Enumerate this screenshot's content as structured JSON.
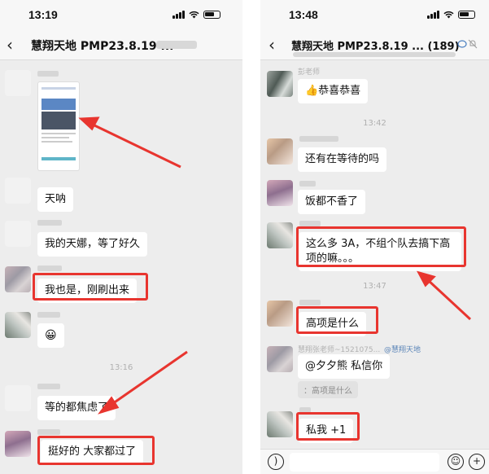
{
  "left": {
    "status_time": "13:19",
    "nav_title": "慧翔天地 PMP23.8.19 ...",
    "timestamps": [
      "13:16"
    ],
    "messages": [
      {
        "text": "天呐"
      },
      {
        "text": "我的天娜，等了好久"
      },
      {
        "text": "我也是，刚刷出来"
      },
      {
        "text": "😀"
      },
      {
        "text": "等的都焦虑了"
      },
      {
        "text": "挺好的 大家都过了"
      }
    ],
    "icons": {
      "back": "back-chevron-icon",
      "signal": "signal-icon",
      "wifi": "wifi-icon",
      "battery": "battery-icon"
    }
  },
  "right": {
    "status_time": "13:48",
    "nav_title": "慧翔天地 PMP23.8.19 ... (189)",
    "timestamps": [
      "13:42",
      "13:47"
    ],
    "sender_names": [
      "彭老师",
      "慧翔张老师~1521075..."
    ],
    "group_tag": "@慧翔天地",
    "messages": [
      {
        "text": "👍恭喜恭喜"
      },
      {
        "text": "还有在等待的吗"
      },
      {
        "text": "饭都不香了"
      },
      {
        "text": "这么多 3A，不组个队去搞下高项的嘛。。。"
      },
      {
        "text": "高项是什么"
      },
      {
        "text": "@夕夕熊 私信你"
      },
      {
        "text": "私我 +1"
      }
    ],
    "quote": "：高项是什么",
    "icons": {
      "back": "back-chevron-icon",
      "voice": "voice-icon",
      "emoji": "emoji-icon",
      "plus": "plus-icon",
      "mute": "mute-bell-icon",
      "chat": "chat-bubble-icon"
    }
  },
  "colors": {
    "highlight": "#e8352f",
    "chat_bg": "#ededed",
    "bubble": "#ffffff"
  }
}
